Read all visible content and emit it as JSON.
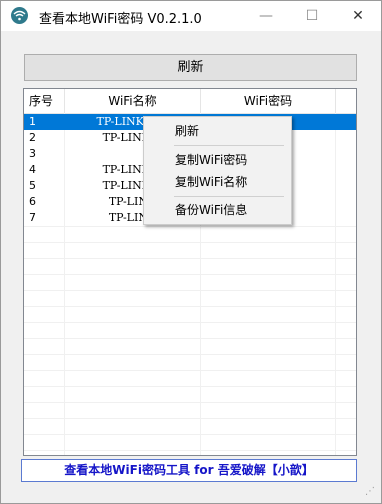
{
  "window": {
    "title": "查看本地WiFi密码 V0.2.1.0",
    "min_glyph": "—",
    "max_glyph": "☐",
    "close_glyph": "✕",
    "app_icon": "wifi-icon"
  },
  "toolbar": {
    "refresh_label": "刷新"
  },
  "table": {
    "headers": [
      "序号",
      "WiFi名称",
      "WiFi密码"
    ],
    "rows": [
      {
        "index": "1",
        "name": "TP-LINK_5(  )",
        "password": "  ",
        "selected": true
      },
      {
        "index": "2",
        "name": "TP-LINK_5",
        "password": "",
        "selected": false
      },
      {
        "index": "3",
        "name": "",
        "password": "6",
        "selected": false
      },
      {
        "index": "4",
        "name": "TP-LINK_5",
        "password": "",
        "selected": false
      },
      {
        "index": "5",
        "name": "TP-LINK_5",
        "password": "",
        "selected": false
      },
      {
        "index": "6",
        "name": "TP-LINK",
        "password": "",
        "selected": false
      },
      {
        "index": "7",
        "name": "TP-LINK",
        "password": "",
        "selected": false
      }
    ]
  },
  "context_menu": {
    "items": [
      "刷新",
      "复制WiFi密码",
      "复制WiFi名称",
      "备份WiFi信息"
    ]
  },
  "footer": {
    "text": "查看本地WiFi密码工具 for 吾爱破解【小歆】"
  },
  "colors": {
    "selection": "#0078d7",
    "footer_text": "#1515c8"
  }
}
